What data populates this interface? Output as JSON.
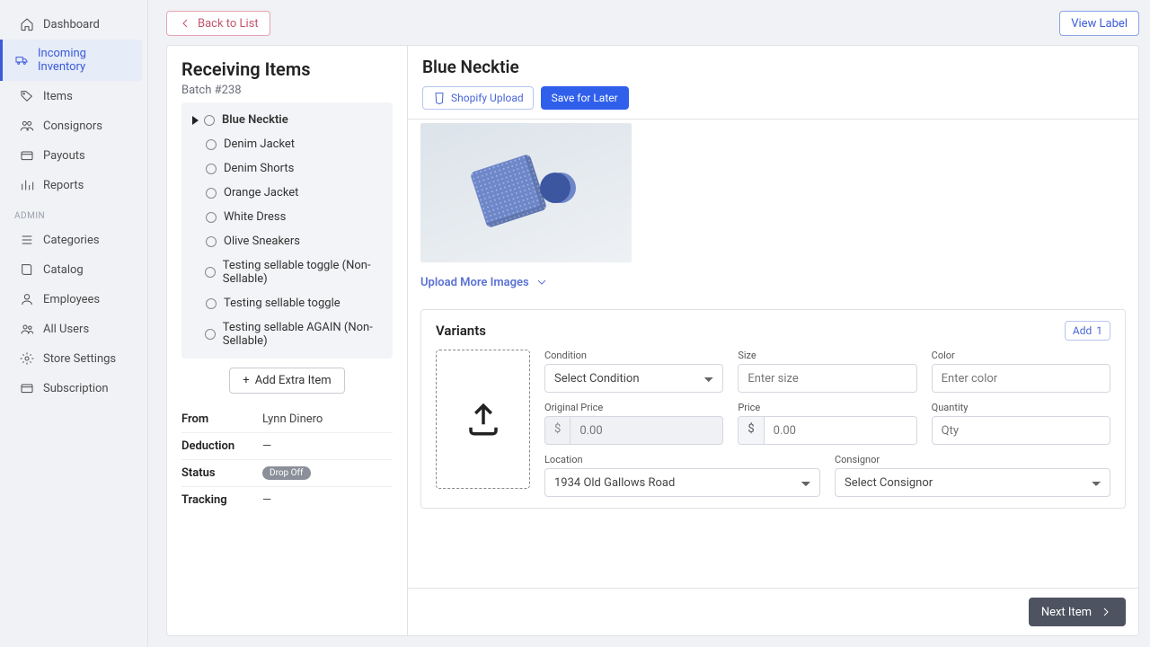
{
  "sidebar": {
    "main": [
      {
        "icon": "home",
        "label": "Dashboard"
      },
      {
        "icon": "truck",
        "label": "Incoming Inventory",
        "active": true
      },
      {
        "icon": "tag",
        "label": "Items"
      },
      {
        "icon": "users",
        "label": "Consignors"
      },
      {
        "icon": "card",
        "label": "Payouts"
      },
      {
        "icon": "bars",
        "label": "Reports"
      }
    ],
    "admin_label": "ADMIN",
    "admin": [
      {
        "icon": "list",
        "label": "Categories"
      },
      {
        "icon": "book",
        "label": "Catalog"
      },
      {
        "icon": "user",
        "label": "Employees"
      },
      {
        "icon": "group",
        "label": "All Users"
      },
      {
        "icon": "gear",
        "label": "Store Settings"
      },
      {
        "icon": "card",
        "label": "Subscription"
      }
    ]
  },
  "topbar": {
    "back": "Back to List",
    "view_label": "View Label"
  },
  "left_panel": {
    "title": "Receiving Items",
    "batch": "Batch #238",
    "items": [
      "Blue Necktie",
      "Denim Jacket",
      "Denim Shorts",
      "Orange Jacket",
      "White Dress",
      "Olive Sneakers",
      "Testing sellable toggle (Non-Sellable)",
      "Testing sellable toggle",
      "Testing sellable AGAIN (Non-Sellable)"
    ],
    "add_extra": "Add Extra Item",
    "meta": {
      "from_label": "From",
      "from_val": "Lynn Dinero",
      "deduction_label": "Deduction",
      "deduction_val": "—",
      "status_label": "Status",
      "status_val": "Drop Off",
      "tracking_label": "Tracking",
      "tracking_val": "—"
    }
  },
  "detail": {
    "title": "Blue Necktie",
    "shopify": "Shopify Upload",
    "save": "Save for Later",
    "upload_more": "Upload More Images",
    "variants_title": "Variants",
    "add": "Add",
    "add_count": "1",
    "labels": {
      "condition": "Condition",
      "size": "Size",
      "color": "Color",
      "original_price": "Original Price",
      "price": "Price",
      "quantity": "Quantity",
      "location": "Location",
      "consignor": "Consignor"
    },
    "placeholders": {
      "condition": "Select Condition",
      "size": "Enter size",
      "color": "Enter color",
      "original_price": "0.00",
      "price": "0.00",
      "quantity": "Qty",
      "location": "1934 Old Gallows Road",
      "consignor": "Select Consignor"
    },
    "currency": "$",
    "next": "Next Item"
  }
}
